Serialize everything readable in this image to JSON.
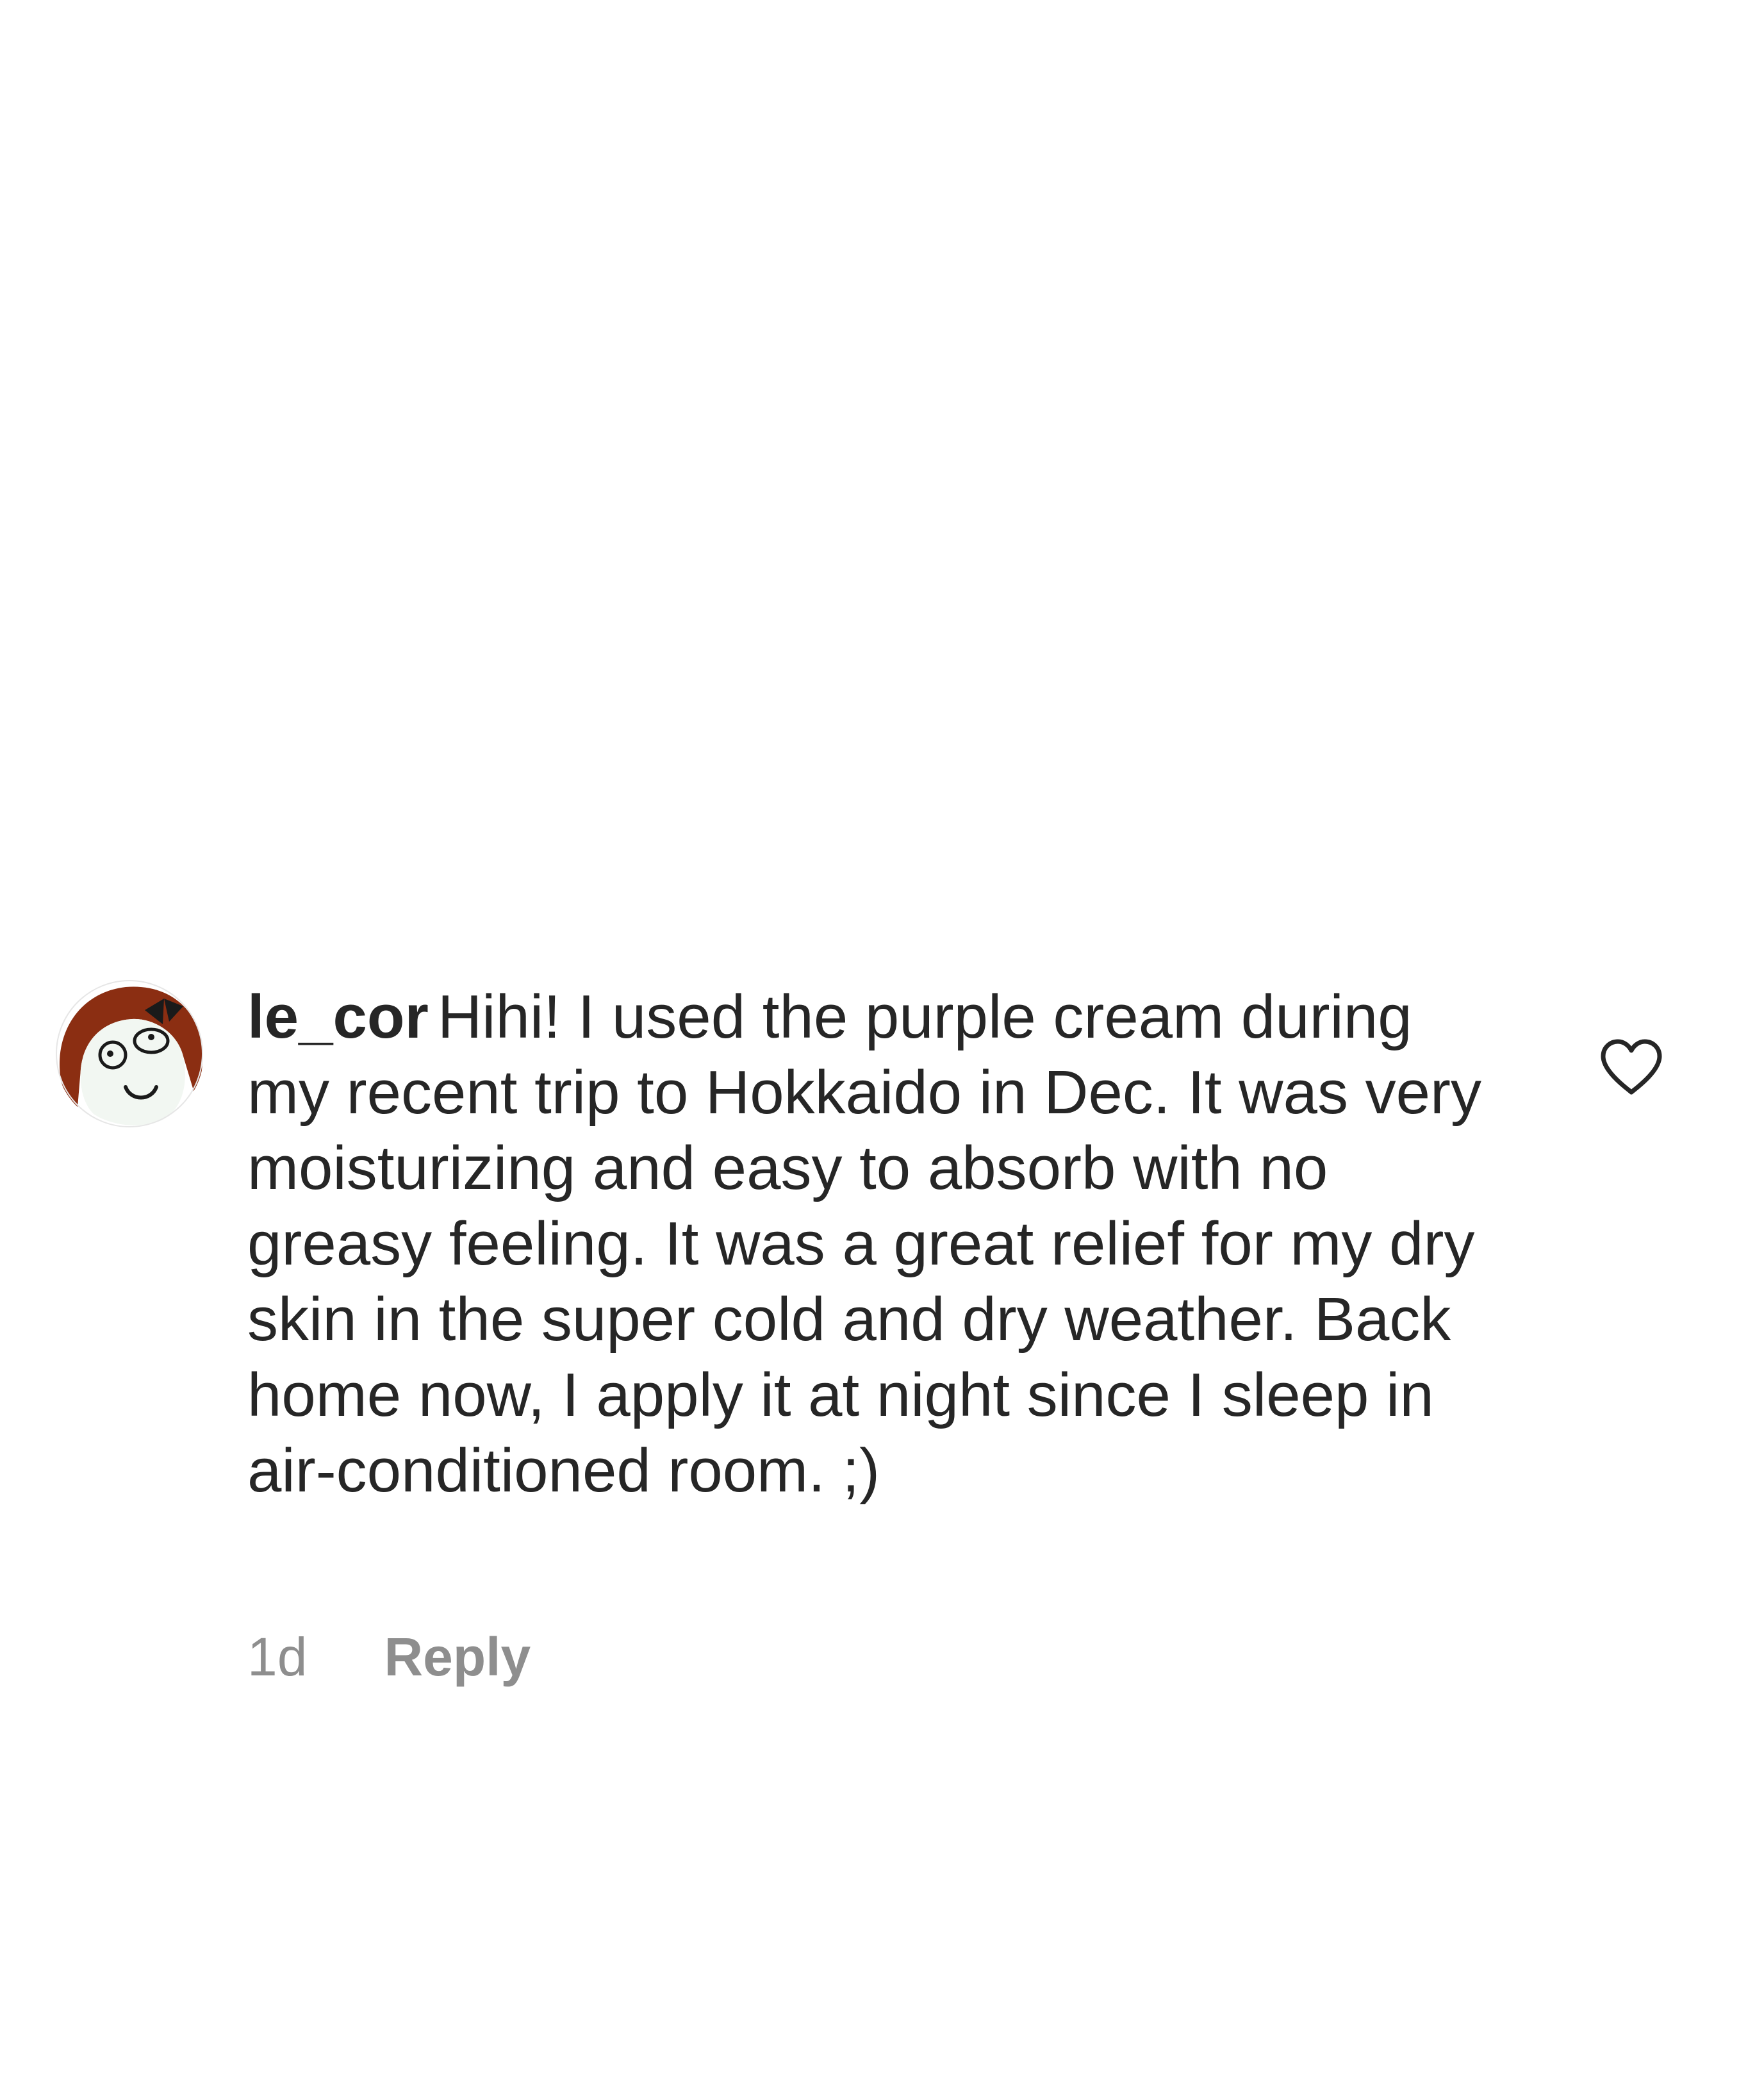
{
  "comment": {
    "username": "le_cor",
    "text": "Hihi! I used the purple cream during my recent trip to Hokkaido in Dec. It was very moisturizing and easy to absorb with no greasy feeling. It was a great relief for my dry skin in the super cold and dry weather. Back home now, I apply it at night since I sleep in air-conditioned room. ;)",
    "timestamp": "1d",
    "reply_label": "Reply",
    "like_icon": "heart-outline-icon",
    "avatar_icon": "cartoon-face-avatar"
  },
  "colors": {
    "text_primary": "#262626",
    "text_secondary": "#8e8e8e",
    "background": "#ffffff",
    "avatar_hair": "#8b2e12"
  }
}
